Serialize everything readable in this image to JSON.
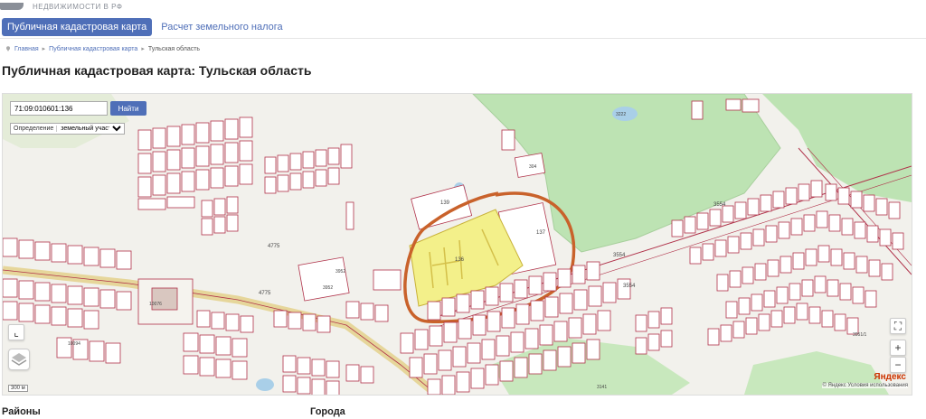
{
  "header": {
    "logo_text": "НЕДВИЖИМОСТИ В РФ",
    "tabs": [
      {
        "label": "Публичная кадастровая карта",
        "active": true
      },
      {
        "label": "Расчет земельного налога",
        "active": false
      }
    ]
  },
  "breadcrumb": {
    "home": "Главная",
    "section": "Публичная кадастровая карта",
    "current": "Тульская область"
  },
  "page_title": "Публичная кадастровая карта: Тульская область",
  "map": {
    "search_value": "71:09:010601:136",
    "search_button": "Найти",
    "definition_label": "Определение",
    "definition_selected": "земельный участок",
    "scale": "300 м",
    "yandex": "Яндекс",
    "copyright": "© Яндекс Условия использования",
    "plot_labels": {
      "target": "136",
      "north": "139",
      "east": "137",
      "lake": "3222",
      "north_small": "304",
      "mid_left": "4775",
      "mid_left_2": "4775",
      "east_field": "3554",
      "east_field_2": "3554",
      "far_east": "3554",
      "near_road": "3952",
      "near_road_2": "3952",
      "factory": "10076",
      "bottom_left": "10094",
      "bottom_right": "3141",
      "right_bottom": "3951/1"
    },
    "colors": {
      "forest": "#bde3b3",
      "boundary": "#b0324a",
      "selected_plot": "#f3f08a",
      "highlight_circle": "#c9622b",
      "road": "#e6d69a",
      "water": "#a9cfe8",
      "button": "#4f6fb8"
    }
  },
  "sections": {
    "left": "Районы",
    "right": "Города"
  }
}
